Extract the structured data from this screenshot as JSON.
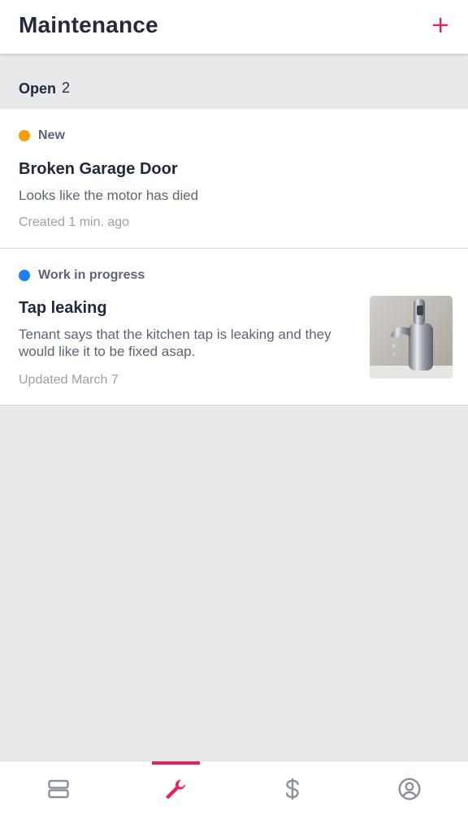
{
  "header": {
    "title": "Maintenance",
    "add_icon": "plus-icon",
    "accent_color": "#e8205f"
  },
  "section": {
    "title": "Open",
    "count": "2"
  },
  "requests": [
    {
      "status": "New",
      "status_color": "#f59e0b",
      "title": "Broken Garage Door",
      "description": "Looks like the motor has died",
      "meta": "Created 1 min. ago"
    },
    {
      "status": "Work in progress",
      "status_color": "#1a82f5",
      "title": "Tap leaking",
      "description": "Tenant says that the kitchen tap is leaking and they would like it to be fixed asap.",
      "meta": "Updated March 7",
      "thumbnail": "leaking-tap-photo"
    }
  ],
  "bottom_nav": {
    "items": [
      {
        "icon": "properties-icon",
        "active": false
      },
      {
        "icon": "wrench-icon",
        "active": true
      },
      {
        "icon": "dollar-icon",
        "active": false
      },
      {
        "icon": "profile-icon",
        "active": false
      }
    ],
    "active_color": "#e8205f",
    "inactive_color": "#8a919c"
  }
}
